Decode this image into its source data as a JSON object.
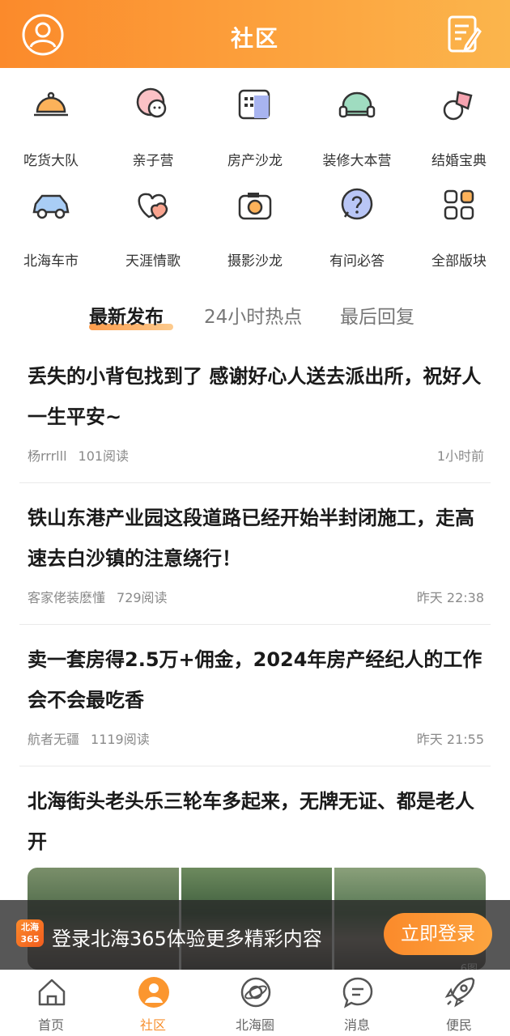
{
  "header": {
    "title": "社区"
  },
  "categories": [
    {
      "label": "吃货大队",
      "icon": "food-cloche-icon"
    },
    {
      "label": "亲子营",
      "icon": "parent-child-icon"
    },
    {
      "label": "房产沙龙",
      "icon": "building-icon"
    },
    {
      "label": "装修大本营",
      "icon": "sofa-icon"
    },
    {
      "label": "结婚宝典",
      "icon": "wedding-icon"
    },
    {
      "label": "北海车市",
      "icon": "car-icon"
    },
    {
      "label": "天涯情歌",
      "icon": "hearts-icon"
    },
    {
      "label": "摄影沙龙",
      "icon": "camera-icon"
    },
    {
      "label": "有问必答",
      "icon": "question-bubble-icon"
    },
    {
      "label": "全部版块",
      "icon": "grid-icon"
    }
  ],
  "tabs": [
    "最新发布",
    "24小时热点",
    "最后回复"
  ],
  "articles": [
    {
      "title": "丢失的小背包找到了 感谢好心人送去派出所，祝好人一生平安~",
      "author": "杨rrrlll",
      "reads": "101阅读",
      "time": "1小时前"
    },
    {
      "title": "铁山东港产业园这段道路已经开始半封闭施工，走高速去白沙镇的注意绕行！",
      "author": "客家佬装麽懂",
      "reads": "729阅读",
      "time": "昨天 22:38"
    },
    {
      "title": "卖一套房得2.5万+佣金，2024年房产经纪人的工作会不会最吃香",
      "author": "航者无疆",
      "reads": "1119阅读",
      "time": "昨天 21:55"
    },
    {
      "title": "北海街头老头乐三轮车多起来，无牌无证、都是老人开",
      "image_count": "6图"
    }
  ],
  "login_banner": {
    "logo_line1": "北海",
    "logo_line2": "365",
    "message": "登录北海365体验更多精彩内容",
    "button": "立即登录"
  },
  "bottom_nav": [
    {
      "label": "首页",
      "icon": "home-icon",
      "active": false
    },
    {
      "label": "社区",
      "icon": "community-icon",
      "active": true
    },
    {
      "label": "北海圈",
      "icon": "planet-icon",
      "active": false
    },
    {
      "label": "消息",
      "icon": "message-icon",
      "active": false
    },
    {
      "label": "便民",
      "icon": "rocket-icon",
      "active": false
    }
  ],
  "colors": {
    "accent": "#fb8a2b",
    "accent_light": "#fca43f"
  }
}
